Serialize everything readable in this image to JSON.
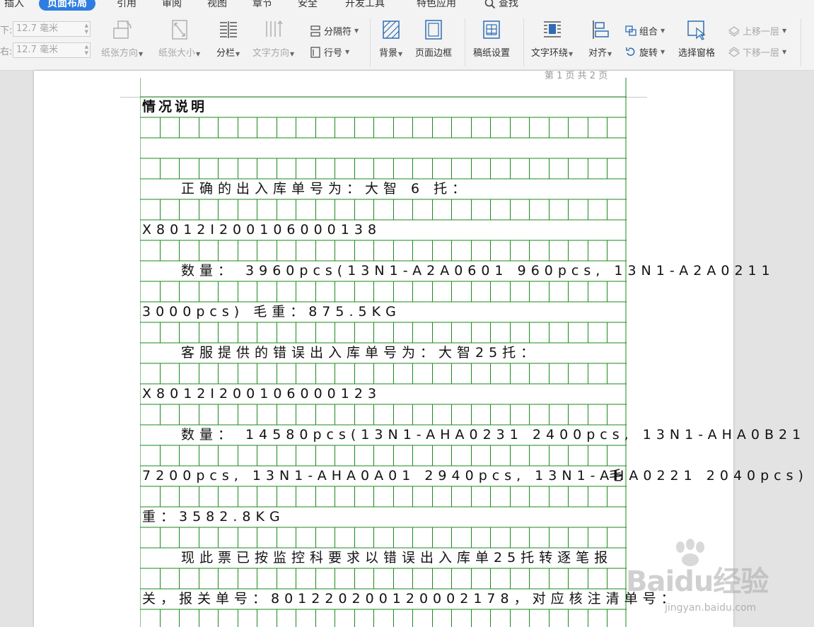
{
  "tabs": [
    {
      "id": "insert",
      "label": "插入"
    },
    {
      "id": "layout",
      "label": "页面布局",
      "active": true
    },
    {
      "id": "references",
      "label": "引用"
    },
    {
      "id": "review",
      "label": "审阅"
    },
    {
      "id": "view",
      "label": "视图"
    },
    {
      "id": "section",
      "label": "章节"
    },
    {
      "id": "security",
      "label": "安全"
    },
    {
      "id": "developer",
      "label": "开发工具"
    },
    {
      "id": "features",
      "label": "特色应用"
    },
    {
      "id": "search",
      "label": "查找"
    }
  ],
  "toolbar": {
    "margin_bottom": {
      "label": "下:",
      "value": "12.7 毫米"
    },
    "margin_right": {
      "label": "右:",
      "value": "12.7 毫米"
    },
    "orientation": "纸张方向",
    "paper_size": "纸张大小",
    "columns": "分栏",
    "text_direction": "文字方向",
    "breaks": "分隔符",
    "line_numbers": "行号",
    "background": "背景",
    "page_border": "页面边框",
    "manuscript": "稿纸设置",
    "text_wrap": "文字环绕",
    "align": "对齐",
    "group": "组合",
    "rotate": "旋转",
    "selection_pane": "选择窗格",
    "bring_forward": "上移一层",
    "send_backward": "下移一层"
  },
  "document": {
    "page_indicator": "第 1 页 共 2 页",
    "lines": [
      {
        "row": 1,
        "text": "情况说明",
        "bold": true,
        "indent": 0
      },
      {
        "row": 5,
        "text": "正确的出入库单号为：大智 6 托：",
        "indent": 2
      },
      {
        "row": 7,
        "text": "X8012I200106000138",
        "indent": 0
      },
      {
        "row": 9,
        "text": "数量： 3960pcs(13N1-A2A0601 960pcs, 13N1-A2A0211",
        "indent": 2
      },
      {
        "row": 11,
        "text": "3000pcs)  毛重：875.5KG",
        "indent": 0
      },
      {
        "row": 13,
        "text": "客服提供的错误出入库单号为：大智25托：",
        "indent": 2
      },
      {
        "row": 15,
        "text": "X8012I200106000123",
        "indent": 0
      },
      {
        "row": 17,
        "text": "数量： 14580pcs(13N1-AHA0231 2400pcs, 13N1-AHA0B21",
        "indent": 2
      },
      {
        "row": 19,
        "text": "7200pcs, 13N1-AHA0A01 2940pcs, 13N1-AHA0221 2040pcs)",
        "indent": 0
      },
      {
        "row": 19,
        "text": "毛",
        "indent": 24
      },
      {
        "row": 21,
        "text": "重：3582.8KG",
        "indent": 0
      },
      {
        "row": 23,
        "text": "现此票已按监控科要求以错误出入库单25托转逐笔报",
        "indent": 2
      },
      {
        "row": 25,
        "text": "关，报关单号：801220200120002178，对应核注清单号：",
        "indent": 0
      }
    ]
  },
  "watermark": {
    "text": "Baidu经验",
    "url": "jingyan.baidu.com"
  },
  "colors": {
    "accent": "#2e7de1",
    "grid": "#1a8a1a",
    "ribbon_bg": "#f3f3f3"
  }
}
